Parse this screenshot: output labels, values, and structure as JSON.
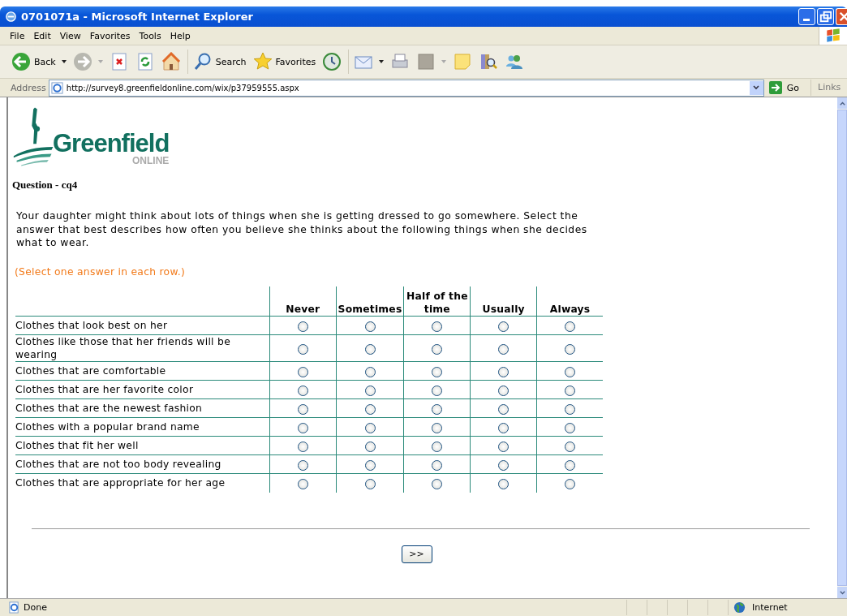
{
  "window": {
    "title": "0701071a - Microsoft Internet Explorer"
  },
  "menu": [
    "File",
    "Edit",
    "View",
    "Favorites",
    "Tools",
    "Help"
  ],
  "toolbar": [
    {
      "kind": "back",
      "label": "Back"
    },
    {
      "kind": "forward"
    },
    {
      "kind": "stop"
    },
    {
      "kind": "refresh"
    },
    {
      "kind": "home"
    },
    {
      "kind": "search",
      "label": "Search"
    },
    {
      "kind": "favorites",
      "label": "Favorites"
    },
    {
      "kind": "history"
    },
    {
      "kind": "mail"
    },
    {
      "kind": "print"
    },
    {
      "kind": "edit"
    },
    {
      "kind": "note"
    },
    {
      "kind": "research"
    },
    {
      "kind": "messenger"
    }
  ],
  "address_bar": {
    "label": "Address",
    "url": "http://survey8.greenfieldonline.com/wix/p37959555.aspx",
    "go": "Go",
    "links": "Links"
  },
  "page": {
    "logo": {
      "name": "Greenfield",
      "tagline": "ONLINE"
    },
    "question_label": "Question - cq4",
    "prompt": "Your daughter might think about lots of things when she is getting dressed to go somewhere. Select the answer that best describes how often you believe she thinks about the following things when she decides what to wear.",
    "instruction": "(Select one answer in each row.)",
    "columns": [
      "Never",
      "Sometimes",
      "Half of the time",
      "Usually",
      "Always"
    ],
    "rows": [
      {
        "label": "Clothes that look best on her",
        "options": [
          {
            "selected": false
          },
          {
            "selected": false
          },
          {
            "selected": false
          },
          {
            "selected": false
          },
          {
            "selected": false
          }
        ]
      },
      {
        "label": "Clothes like those that her friends will be wearing",
        "options": [
          {
            "selected": false
          },
          {
            "selected": false
          },
          {
            "selected": false
          },
          {
            "selected": false
          },
          {
            "selected": false
          }
        ]
      },
      {
        "label": "Clothes that are comfortable",
        "options": [
          {
            "selected": false
          },
          {
            "selected": false
          },
          {
            "selected": false
          },
          {
            "selected": false
          },
          {
            "selected": false
          }
        ]
      },
      {
        "label": "Clothes that are her favorite color",
        "options": [
          {
            "selected": false
          },
          {
            "selected": false
          },
          {
            "selected": false
          },
          {
            "selected": false
          },
          {
            "selected": false
          }
        ]
      },
      {
        "label": "Clothes that are the newest fashion",
        "options": [
          {
            "selected": false
          },
          {
            "selected": false
          },
          {
            "selected": false
          },
          {
            "selected": false
          },
          {
            "selected": false
          }
        ]
      },
      {
        "label": "Clothes with a popular brand name",
        "options": [
          {
            "selected": false
          },
          {
            "selected": false
          },
          {
            "selected": false
          },
          {
            "selected": false
          },
          {
            "selected": false
          }
        ]
      },
      {
        "label": "Clothes that fit her well",
        "options": [
          {
            "selected": false
          },
          {
            "selected": false
          },
          {
            "selected": false
          },
          {
            "selected": false
          },
          {
            "selected": false
          }
        ]
      },
      {
        "label": "Clothes that are not too body revealing",
        "options": [
          {
            "selected": false
          },
          {
            "selected": false
          },
          {
            "selected": false
          },
          {
            "selected": false
          },
          {
            "selected": false
          }
        ]
      },
      {
        "label": "Clothes that are appropriate for her age",
        "options": [
          {
            "selected": false
          },
          {
            "selected": false
          },
          {
            "selected": false
          },
          {
            "selected": false
          },
          {
            "selected": false
          }
        ]
      }
    ],
    "next_button": ">>"
  },
  "status_bar": {
    "status": "Done",
    "zone": "Internet"
  }
}
